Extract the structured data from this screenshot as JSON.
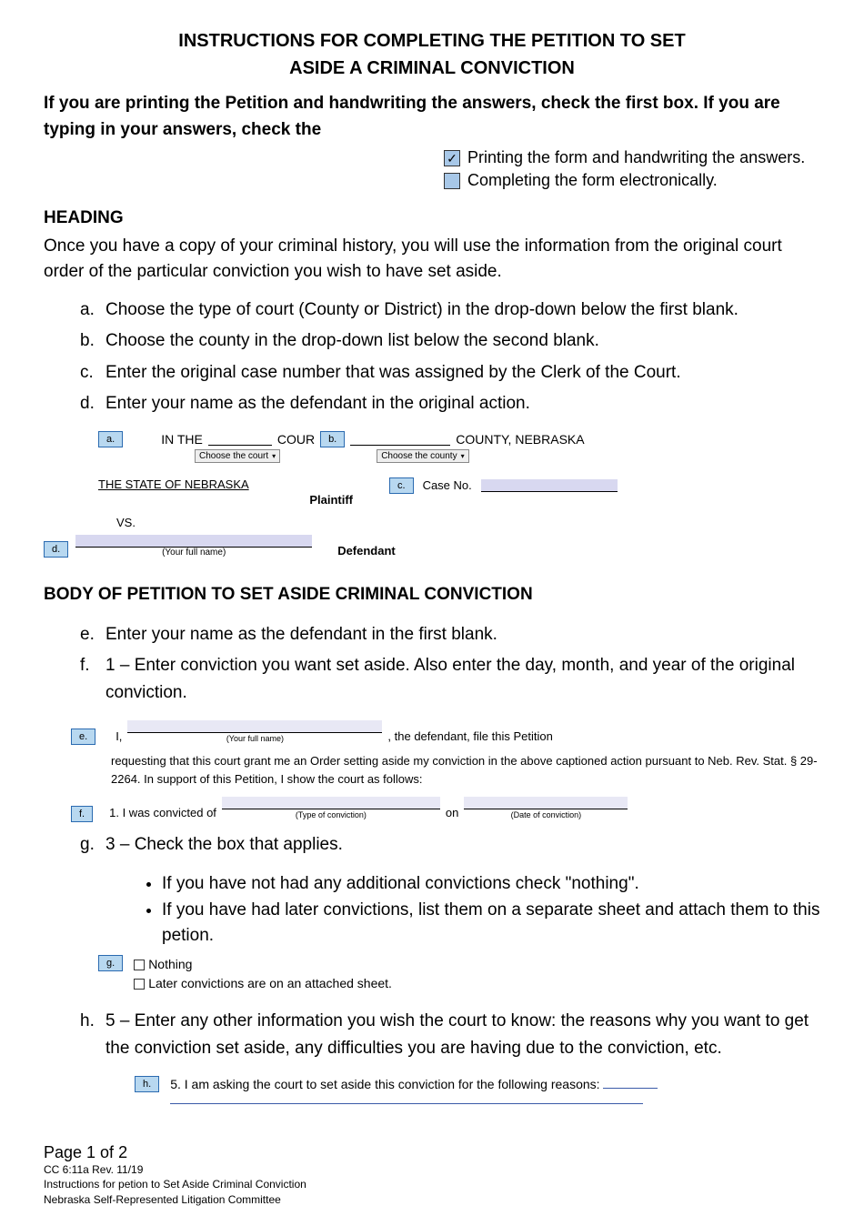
{
  "title_line1": "INSTRUCTIONS FOR COMPLETING THE PETITION TO SET",
  "title_line2": "ASIDE A CRIMINAL CONVICTION",
  "intro": "If you are printing the Petition and handwriting the answers, check the first box. If you are typing in your answers, check the",
  "opts": {
    "print": "Printing the form and handwriting the answers.",
    "electronic": "Completing the form electronically."
  },
  "heading_label": "HEADING",
  "heading_para": "Once you have a copy of your criminal history, you will use the information from the original court order of the particular conviction you wish to have set aside.",
  "list1": {
    "a": "Choose the type of court (County or District) in the drop-down below the first blank.",
    "b": "Choose the county in the drop-down list below the second blank.",
    "c": "Enter the original case number that was assigned by the Clerk of the Court.",
    "d": "Enter your name as the defendant in the original action."
  },
  "example1": {
    "in_the": "IN THE",
    "court": "COUR",
    "county_ne": "COUNTY, NEBRASKA",
    "choose_court": "Choose the court",
    "choose_county": "Choose the county",
    "state": "THE STATE OF NEBRASKA",
    "plaintiff": "Plaintiff",
    "case_no": "Case No.",
    "vs": "VS.",
    "your_full_name": "(Your full name)",
    "defendant": "Defendant"
  },
  "body_title": "BODY OF PETITION TO SET ASIDE CRIMINAL CONVICTION",
  "list2": {
    "e": "Enter your name as the defendant in the first blank.",
    "f": "1 – Enter conviction you want set aside. Also enter the day, month, and year of the original conviction."
  },
  "pet_ex": {
    "i": "I,",
    "defendant_file": ", the defendant, file this Petition",
    "your_full_name": "(Your full name)",
    "req_line": "requesting that this court grant me an Order setting aside my conviction in the above captioned action  pursuant to Neb. Rev. Stat. § 29-2264. In support of this Petition, I show the court as follows:",
    "convicted_of": "1.   I was convicted of",
    "type_conv": "(Type of conviction)",
    "on": "on",
    "date_conv": "(Date of conviction)"
  },
  "g_line": "3 – Check the box that applies.",
  "g_bullets": {
    "b1": "If you have not had any additional convictions check \"nothing\".",
    "b2": "If you have had later convictions, list them on a separate sheet and attach them to this petion."
  },
  "g_opts": {
    "nothing": "Nothing",
    "later": "Later convictions are on an attached sheet."
  },
  "h_line": "5 – Enter any other information you wish the court to know: the reasons why you want to get the conviction set aside, any difficulties you are having due to the conviction, etc.",
  "h_ex": "5.   I am asking the court to set aside this conviction for the following reasons:",
  "footer": {
    "page": "Page 1 of 2",
    "cc": "CC 6:11a Rev. 11/19",
    "instr": "Instructions for petion to Set Aside Criminal Conviction",
    "committee": "Nebraska Self-Represented Litigation Committee"
  },
  "tags": {
    "a": "a.",
    "b": "b.",
    "c": "c.",
    "d": "d.",
    "e": "e.",
    "f": "f.",
    "g": "g.",
    "h": "h."
  }
}
